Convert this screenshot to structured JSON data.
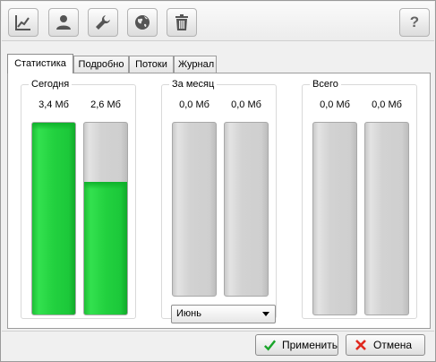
{
  "toolbar": {
    "buttons": [
      {
        "name": "chart-icon"
      },
      {
        "name": "user-icon"
      },
      {
        "name": "wrench-icon"
      },
      {
        "name": "globe-icon"
      },
      {
        "name": "trash-icon"
      },
      {
        "name": "help-icon",
        "label": "?"
      }
    ]
  },
  "tabs": [
    {
      "label": "Статистика",
      "active": true
    },
    {
      "label": "Подробно",
      "active": false
    },
    {
      "label": "Потоки",
      "active": false
    },
    {
      "label": "Журнал",
      "active": false
    }
  ],
  "groups": {
    "today": {
      "title": "Сегодня",
      "values": [
        "3,4 Мб",
        "2,6 Мб"
      ],
      "levels": [
        1.0,
        0.69
      ]
    },
    "month": {
      "title": "За месяц",
      "values": [
        "0,0 Мб",
        "0,0 Мб"
      ],
      "levels": [
        0,
        0
      ],
      "select": {
        "value": "Июнь"
      }
    },
    "total": {
      "title": "Всего",
      "values": [
        "0,0 Мб",
        "0,0 Мб"
      ],
      "levels": [
        0,
        0
      ]
    }
  },
  "footer": {
    "apply_label": "Применить",
    "cancel_label": "Отмена"
  },
  "colors": {
    "fill": "#22d13f",
    "empty": "#d2d2d2",
    "apply_icon": "#1aa52a",
    "cancel_icon": "#e0281e"
  }
}
